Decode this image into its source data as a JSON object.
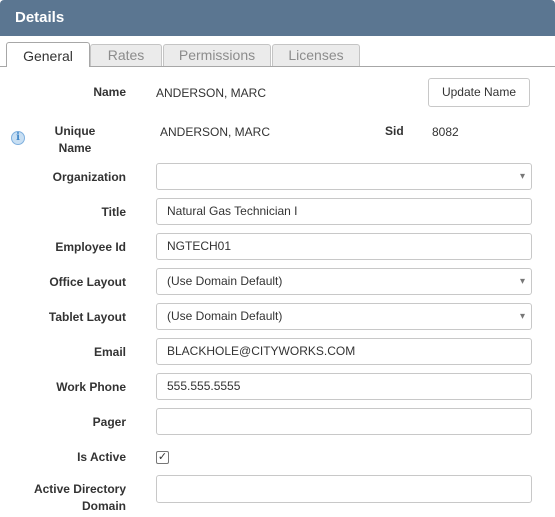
{
  "header": {
    "title": "Details"
  },
  "tabs": [
    {
      "label": "General",
      "active": true
    },
    {
      "label": "Rates",
      "active": false
    },
    {
      "label": "Permissions",
      "active": false
    },
    {
      "label": "Licenses",
      "active": false
    }
  ],
  "fields": {
    "name": {
      "label": "Name",
      "value": "ANDERSON, MARC"
    },
    "update_name_button": "Update Name",
    "unique_name": {
      "label_line1": "Unique",
      "label_line2": "Name",
      "value": "ANDERSON, MARC"
    },
    "sid": {
      "label": "Sid",
      "value": "8082"
    },
    "organization": {
      "label": "Organization",
      "value": ""
    },
    "title": {
      "label": "Title",
      "value": "Natural Gas Technician I"
    },
    "employee_id": {
      "label": "Employee Id",
      "value": "NGTECH01"
    },
    "office_layout": {
      "label": "Office Layout",
      "value": "(Use Domain Default)"
    },
    "tablet_layout": {
      "label": "Tablet Layout",
      "value": "(Use Domain Default)"
    },
    "email": {
      "label": "Email",
      "value": "BLACKHOLE@CITYWORKS.COM"
    },
    "work_phone": {
      "label": "Work Phone",
      "value": "555.555.5555"
    },
    "pager": {
      "label": "Pager",
      "value": ""
    },
    "is_active": {
      "label": "Is Active",
      "checked": true,
      "mark": "✓"
    },
    "ad_domain": {
      "label_line1": "Active Directory",
      "label_line2": "Domain",
      "value": ""
    }
  },
  "icons": {
    "info": "i",
    "dropdown": "▾"
  }
}
